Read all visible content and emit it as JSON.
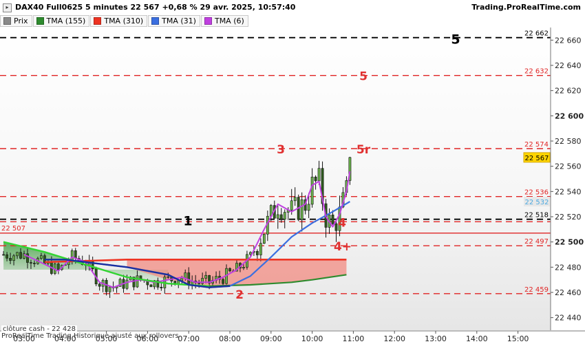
{
  "header": {
    "title": "DAX40 Full0625 5 minutes 22 567 +0,68 % 29 avr. 2025, 10:57:40",
    "brand": "Trading.ProRealTime.com"
  },
  "legend": [
    {
      "label": "Prix",
      "color": "#8a8a8a"
    },
    {
      "label": "TMA (155)",
      "color": "#2e8b2e"
    },
    {
      "label": "TMA (310)",
      "color": "#ee3322"
    },
    {
      "label": "TMA (31)",
      "color": "#3b6fe0"
    },
    {
      "label": "TMA (6)",
      "color": "#c040e0"
    }
  ],
  "footer": {
    "cash_close": "clôture cash - 22 428",
    "note": "ProRealTime Trading Historique ajusté aux rollovers"
  },
  "chart_data": {
    "type": "candlestick",
    "x_ticks": [
      "03:00",
      "04:00",
      "05:00",
      "06:00",
      "07:00",
      "08:00",
      "09:00",
      "10:00",
      "11:00",
      "12:00",
      "13:00",
      "14:00",
      "15:00"
    ],
    "y_ticks": [
      "22 660",
      "22 640",
      "22 620",
      "22 600",
      "22 580",
      "22 560",
      "22 540",
      "22 520",
      "22 500",
      "22 480",
      "22 460",
      "22 440"
    ],
    "ylim": [
      22430,
      22670
    ],
    "last_price": 22567,
    "levels": [
      {
        "value": 22662,
        "label": "22 662",
        "marker": "5",
        "color": "#000000",
        "style": "dashed"
      },
      {
        "value": 22632,
        "label": "22 632",
        "marker": "5",
        "color": "#e02424",
        "style": "dashed"
      },
      {
        "value": 22574,
        "label": "22 574",
        "marker": "3",
        "color": "#e02424",
        "style": "dashed"
      },
      {
        "value": 22536,
        "label": "22 536",
        "marker": "",
        "color": "#e02424",
        "style": "dashed"
      },
      {
        "value": 22518,
        "label": "22 518",
        "marker": "1",
        "color": "#000000",
        "style": "dashed"
      },
      {
        "value": 22516,
        "label": "",
        "marker": "4",
        "color": "#e02424",
        "style": "dashed"
      },
      {
        "value": 22507,
        "label": "22 507",
        "marker": "",
        "color": "#e02424",
        "style": "solid"
      },
      {
        "value": 22497,
        "label": "22 497",
        "marker": "4+",
        "color": "#e02424",
        "style": "dashed"
      },
      {
        "value": 22459,
        "label": "22 459",
        "marker": "2",
        "color": "#e02424",
        "style": "dashed"
      },
      {
        "value": 22428,
        "label": "",
        "marker": "",
        "color": "#1a1aa0",
        "style": "solid"
      }
    ],
    "annotations": [
      {
        "text": "5r",
        "value": 22574
      },
      {
        "text": "22 532",
        "value": 22532
      },
      {
        "text": "22 567",
        "value": 22567
      }
    ],
    "series": [
      {
        "name": "TMA (155)",
        "color": "#2e8b2e",
        "points": [
          [
            "02:30",
            22500
          ],
          [
            "03:30",
            22492
          ],
          [
            "04:30",
            22482
          ],
          [
            "05:30",
            22472
          ],
          [
            "06:30",
            22467
          ],
          [
            "07:30",
            22465
          ],
          [
            "08:30",
            22466
          ],
          [
            "09:30",
            22468
          ],
          [
            "10:00",
            22470
          ],
          [
            "10:50",
            22474
          ]
        ]
      },
      {
        "name": "TMA (310)",
        "color": "#ee3322",
        "points": [
          [
            "03:30",
            22484
          ],
          [
            "04:30",
            22485
          ],
          [
            "05:30",
            22486
          ],
          [
            "06:30",
            22486
          ],
          [
            "07:30",
            22486
          ],
          [
            "08:30",
            22486
          ],
          [
            "09:30",
            22486
          ],
          [
            "10:50",
            22486
          ]
        ]
      },
      {
        "name": "TMA (31)",
        "color": "#3b6fe0",
        "points": [
          [
            "03:30",
            22486
          ],
          [
            "04:00",
            22486
          ],
          [
            "04:30",
            22484
          ],
          [
            "05:30",
            22480
          ],
          [
            "06:30",
            22474
          ],
          [
            "07:00",
            22466
          ],
          [
            "07:30",
            22464
          ],
          [
            "08:00",
            22465
          ],
          [
            "08:30",
            22473
          ],
          [
            "09:00",
            22488
          ],
          [
            "09:30",
            22504
          ],
          [
            "10:00",
            22515
          ],
          [
            "10:30",
            22524
          ],
          [
            "10:55",
            22532
          ]
        ]
      },
      {
        "name": "TMA (6)",
        "color": "#c040e0",
        "points": [
          [
            "03:00",
            22490
          ],
          [
            "03:20",
            22485
          ],
          [
            "03:50",
            22477
          ],
          [
            "04:10",
            22488
          ],
          [
            "04:30",
            22484
          ],
          [
            "04:50",
            22468
          ],
          [
            "05:10",
            22464
          ],
          [
            "05:30",
            22468
          ],
          [
            "05:50",
            22470
          ],
          [
            "06:10",
            22468
          ],
          [
            "06:30",
            22470
          ],
          [
            "06:50",
            22472
          ],
          [
            "07:10",
            22468
          ],
          [
            "07:30",
            22468
          ],
          [
            "07:50",
            22472
          ],
          [
            "08:10",
            22478
          ],
          [
            "08:30",
            22488
          ],
          [
            "08:50",
            22510
          ],
          [
            "09:10",
            22530
          ],
          [
            "09:30",
            22524
          ],
          [
            "09:50",
            22530
          ],
          [
            "10:00",
            22545
          ],
          [
            "10:10",
            22548
          ],
          [
            "10:20",
            22520
          ],
          [
            "10:30",
            22512
          ],
          [
            "10:40",
            22522
          ],
          [
            "10:50",
            22540
          ],
          [
            "10:55",
            22556
          ]
        ]
      }
    ]
  }
}
